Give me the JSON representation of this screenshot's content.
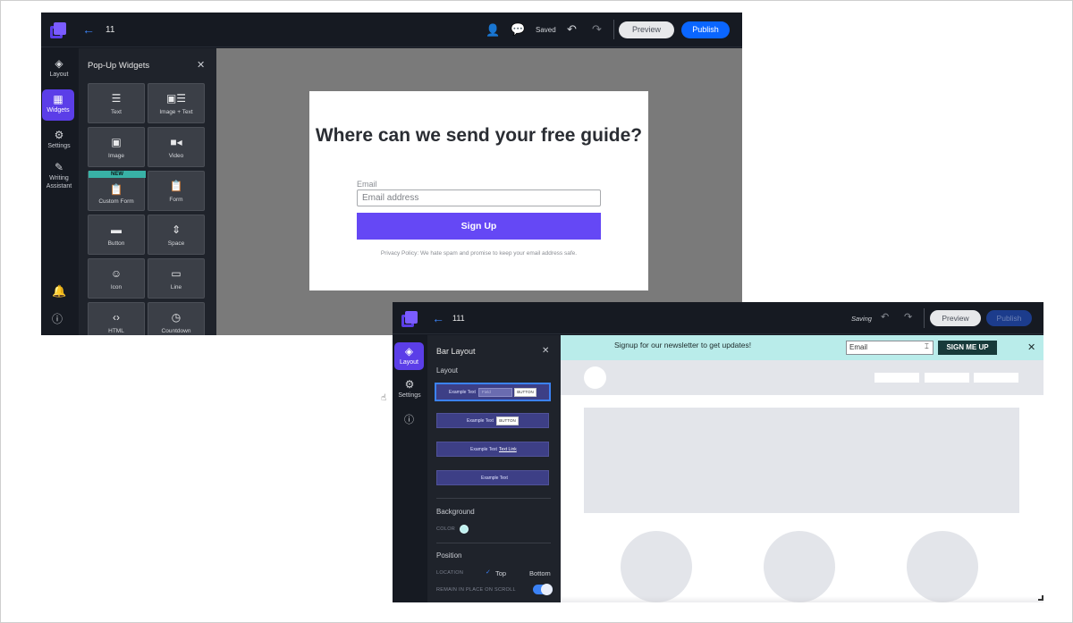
{
  "winA": {
    "title": "11",
    "saved": "Saved",
    "preview_label": "Preview",
    "publish_label": "Publish",
    "nav": [
      {
        "label": "Layout",
        "icon": "layers-icon"
      },
      {
        "label": "Widgets",
        "icon": "widgets-icon"
      },
      {
        "label": "Settings",
        "icon": "gear-icon"
      },
      {
        "label": "Writing Assistant",
        "icon": "magic-wand-icon"
      }
    ],
    "panel_title": "Pop-Up Widgets",
    "widgets": [
      {
        "label": "Text",
        "icon": "text-icon"
      },
      {
        "label": "Image + Text",
        "icon": "image-text-icon"
      },
      {
        "label": "Image",
        "icon": "image-icon"
      },
      {
        "label": "Video",
        "icon": "video-icon"
      },
      {
        "label": "Custom Form",
        "icon": "clipboard-icon",
        "badge": "NEW"
      },
      {
        "label": "Form",
        "icon": "form-icon"
      },
      {
        "label": "Button",
        "icon": "button-icon"
      },
      {
        "label": "Space",
        "icon": "space-icon"
      },
      {
        "label": "Icon",
        "icon": "smiley-icon"
      },
      {
        "label": "Line",
        "icon": "line-icon"
      },
      {
        "label": "HTML",
        "icon": "code-icon"
      },
      {
        "label": "Countdown",
        "icon": "clock-icon"
      }
    ],
    "popup": {
      "headline": "Where can we send your free guide?",
      "email_label": "Email",
      "email_placeholder": "Email address",
      "button_label": "Sign Up",
      "privacy": "Privacy Policy: We hate spam and promise to keep your email address safe."
    }
  },
  "winB": {
    "title": "111",
    "saving": "Saving",
    "preview_label": "Preview",
    "publish_label": "Publish",
    "nav": [
      {
        "label": "Layout",
        "icon": "layers-icon"
      },
      {
        "label": "Settings",
        "icon": "gear-icon"
      }
    ],
    "panel_title": "Bar Layout",
    "layout_section": "Layout",
    "layout_options": [
      {
        "text": "Example Text",
        "field": "Field",
        "button": "BUTTON"
      },
      {
        "text": "Example Text",
        "button": "BUTTON"
      },
      {
        "text": "Example Text",
        "link": "Text Link"
      },
      {
        "text": "Example Text"
      }
    ],
    "background_section": "Background",
    "color_label": "COLOR",
    "background_color": "#bff0ef",
    "position_section": "Position",
    "location_label": "LOCATION",
    "location_options": [
      "Top",
      "Bottom"
    ],
    "location_selected": "Top",
    "remain_label": "REMAIN IN PLACE ON SCROLL",
    "remain_enabled": true,
    "bar": {
      "message": "Signup for our newsletter to get updates!",
      "email_placeholder": "Email",
      "button_label": "SIGN ME UP"
    }
  },
  "colors": {
    "accent_purple": "#5b3ee8",
    "signup_purple": "#6548f5",
    "publish_blue": "#0a66ff",
    "bar_bg": "#b9ecea",
    "bar_button": "#173a3a"
  }
}
